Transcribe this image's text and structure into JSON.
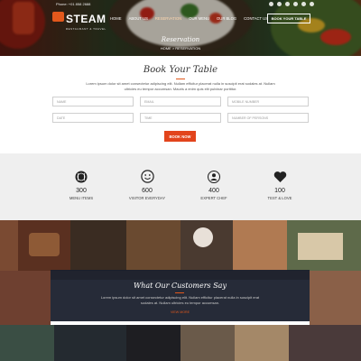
{
  "topbar": {
    "phone": "Phone: +01 858 2688",
    "social_icons": [
      "facebook-icon",
      "twitter-icon",
      "google-plus-icon",
      "pinterest-icon",
      "instagram-icon",
      "youtube-icon"
    ]
  },
  "brand": {
    "name": "STEAM",
    "tagline": "RESTAURANT & TRAVEL"
  },
  "nav": {
    "items": [
      "HOME",
      "ABOUT US",
      "RESERVATION",
      "OUR MENU",
      "OUR BLOG",
      "CONTACT US"
    ],
    "active": "RESERVATION",
    "cta": "BOOK YOUR TABLE"
  },
  "hero": {
    "title": "Reservation",
    "breadcrumb": "HOME > RESERVATION"
  },
  "booking": {
    "title": "Book Your Table",
    "description": "Lorem ipsum dolor sit amet consectetur adipiscing elit. Nullam efficitur placerat nulla in suscipit erat sodales at. Nullam ultricies eu tempor accumsan. Mauris a enim quis elit pulvinar porttitor.",
    "fields": {
      "name": "NAME",
      "email": "EMAIL",
      "mobile": "MOBILE NUMBER",
      "date": "DATE",
      "time": "TIME",
      "persons": "NUMBER OF PERSONS"
    },
    "submit": "BOOK NOW"
  },
  "stats": [
    {
      "icon": "dining-icon",
      "value": "300",
      "label": "MENU ITEMS"
    },
    {
      "icon": "smiley-icon",
      "value": "600",
      "label": "VISITOR EVERYDAY"
    },
    {
      "icon": "chef-icon",
      "value": "400",
      "label": "EXPERT CHEF"
    },
    {
      "icon": "heart-icon",
      "value": "100",
      "label": "TEST & LOVE"
    }
  ],
  "testimonial": {
    "title": "What Our Customers Say",
    "quote": "Lorem ipsum dolor sit amet consectetur adipiscing elit. Nullam efficitur placerat nulla in suscipit erat sodales at. Nullam ultricies eu tempor accumsan.",
    "more": "VIEW MORE"
  },
  "colors": {
    "accent": "#e2581c",
    "dark_box": "#181e2c",
    "stats_bg": "#efefef"
  }
}
